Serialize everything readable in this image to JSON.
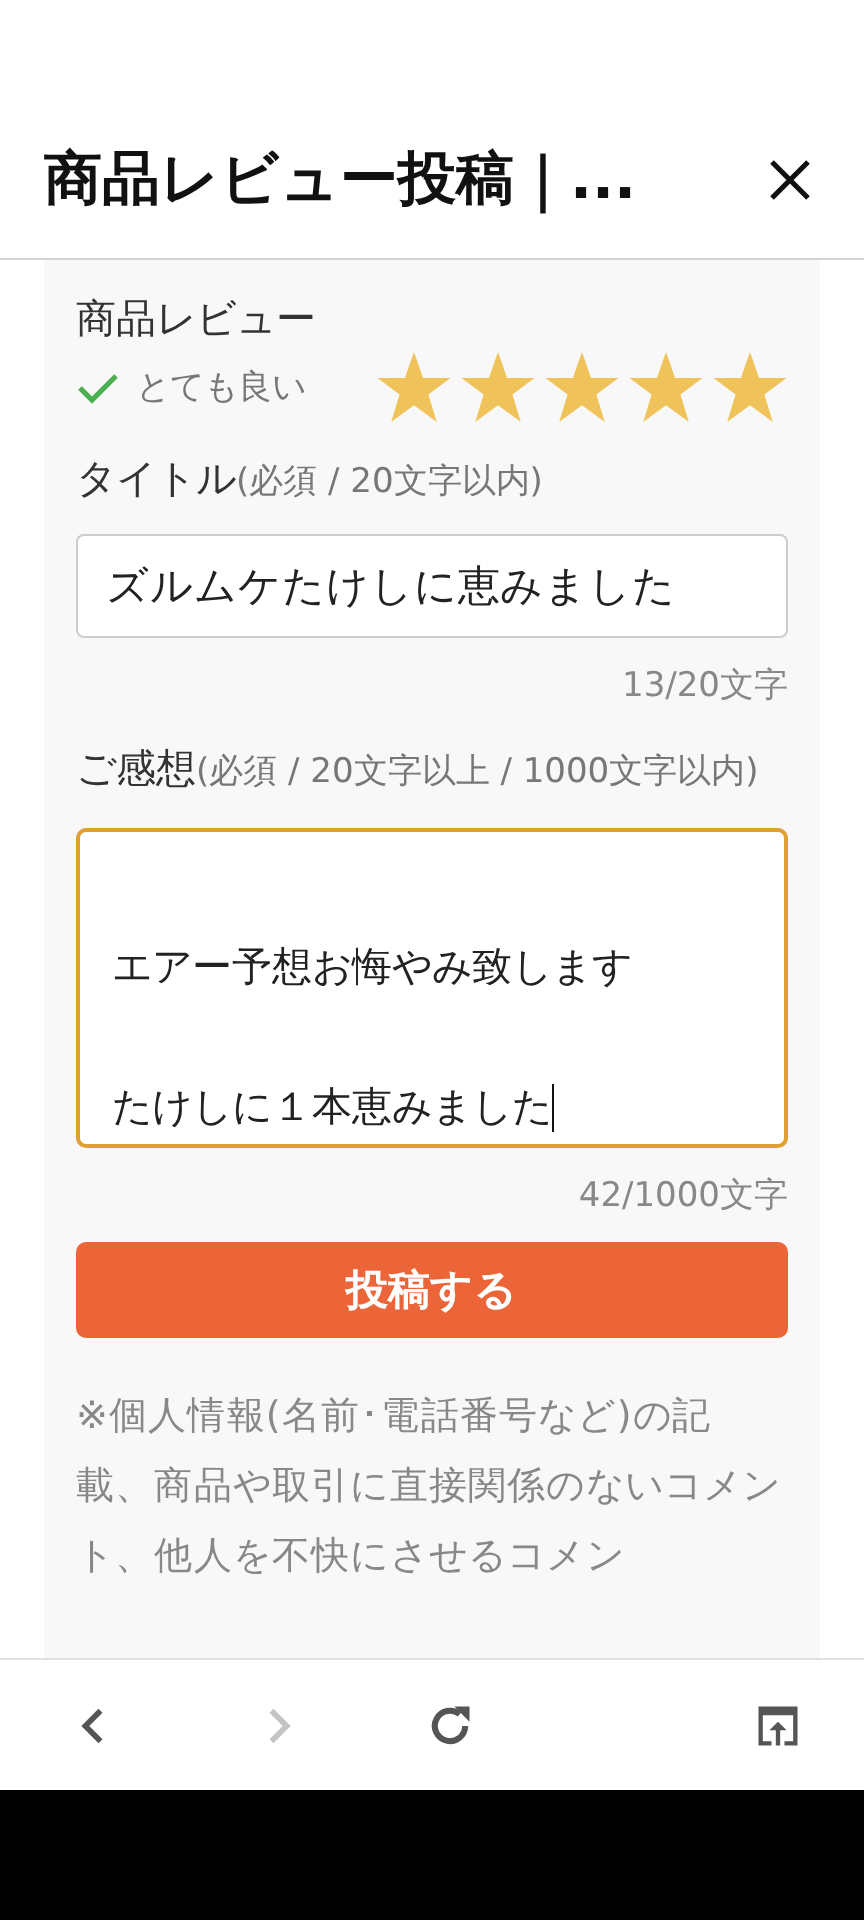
{
  "header": {
    "title": "商品レビュー投稿｜..."
  },
  "review": {
    "label": "商品レビュー",
    "rating_text": "とても良い",
    "stars": 5
  },
  "title_field": {
    "label": "タイトル",
    "hint": "(必須 / 20文字以内)",
    "value": "ズルムケたけしに恵みました",
    "counter": "13/20文字"
  },
  "comment_field": {
    "label": "ご感想",
    "hint": "(必須 / 20文字以上 / 1000文字以内)",
    "focused": true,
    "lines": [
      "エアー予想お悔やみ致します",
      "たけしに１本恵みました"
    ],
    "counter": "42/1000文字"
  },
  "submit_button": "投稿する",
  "notice": "※個人情報(名前･電話番号など)の記載、商品や取引に直接関係のないコメント、他人を不快にさせるコメン",
  "browser_nav": [
    {
      "kind": "back",
      "disabled": false
    },
    {
      "kind": "forward",
      "disabled": true
    },
    {
      "kind": "reload",
      "disabled": false
    },
    {
      "kind": "open",
      "disabled": false
    }
  ]
}
